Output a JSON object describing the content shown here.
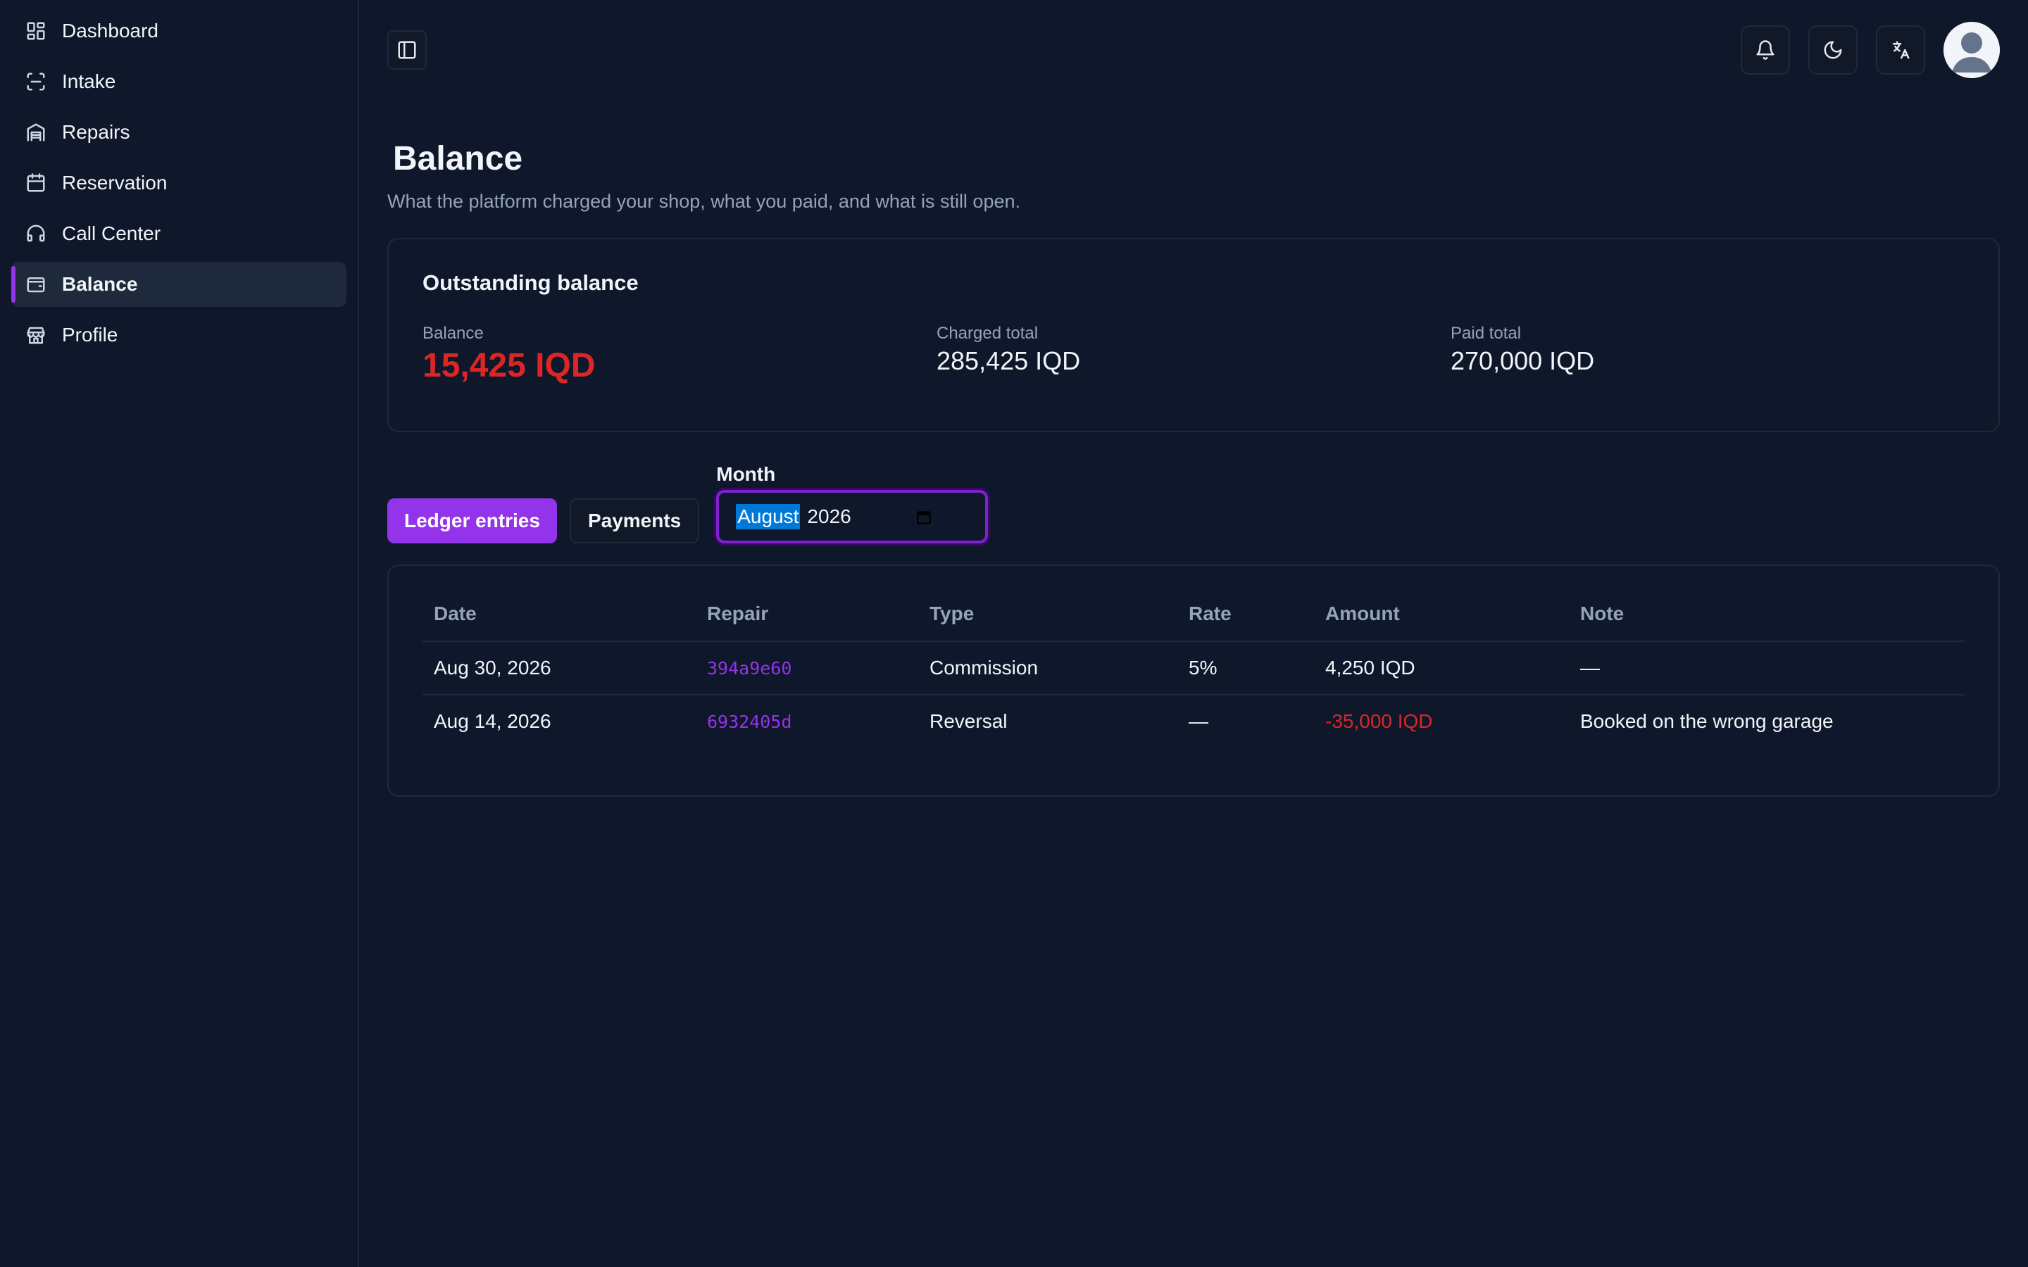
{
  "sidebar": {
    "items": [
      {
        "label": "Dashboard",
        "icon": "dashboard-icon"
      },
      {
        "label": "Intake",
        "icon": "scan-icon"
      },
      {
        "label": "Repairs",
        "icon": "garage-icon"
      },
      {
        "label": "Reservation",
        "icon": "calendar-icon"
      },
      {
        "label": "Call Center",
        "icon": "headset-icon"
      },
      {
        "label": "Balance",
        "icon": "wallet-icon",
        "active": true
      },
      {
        "label": "Profile",
        "icon": "store-icon"
      }
    ]
  },
  "page": {
    "title": "Balance",
    "subtitle": "What the platform charged your shop, what you paid, and what is still open."
  },
  "summary": {
    "title": "Outstanding balance",
    "balance_label": "Balance",
    "balance_value": "15,425 IQD",
    "charged_label": "Charged total",
    "charged_value": "285,425 IQD",
    "paid_label": "Paid total",
    "paid_value": "270,000 IQD"
  },
  "tabs": {
    "ledger": "Ledger entries",
    "payments": "Payments"
  },
  "month": {
    "label": "Month",
    "month_value": "August",
    "year_value": "2026"
  },
  "table": {
    "headers": {
      "date": "Date",
      "repair": "Repair",
      "type": "Type",
      "rate": "Rate",
      "amount": "Amount",
      "note": "Note"
    },
    "rows": [
      {
        "date": "Aug 30, 2026",
        "repair": "394a9e60",
        "type": "Commission",
        "rate": "5%",
        "amount": "4,250 IQD",
        "note": "—"
      },
      {
        "date": "Aug 14, 2026",
        "repair": "6932405d",
        "type": "Reversal",
        "rate": "—",
        "amount": "-35,000 IQD",
        "note": "Booked on the wrong garage"
      }
    ]
  },
  "colors": {
    "accent": "#9333ea",
    "danger": "#dc2626",
    "background": "#0f172a"
  }
}
